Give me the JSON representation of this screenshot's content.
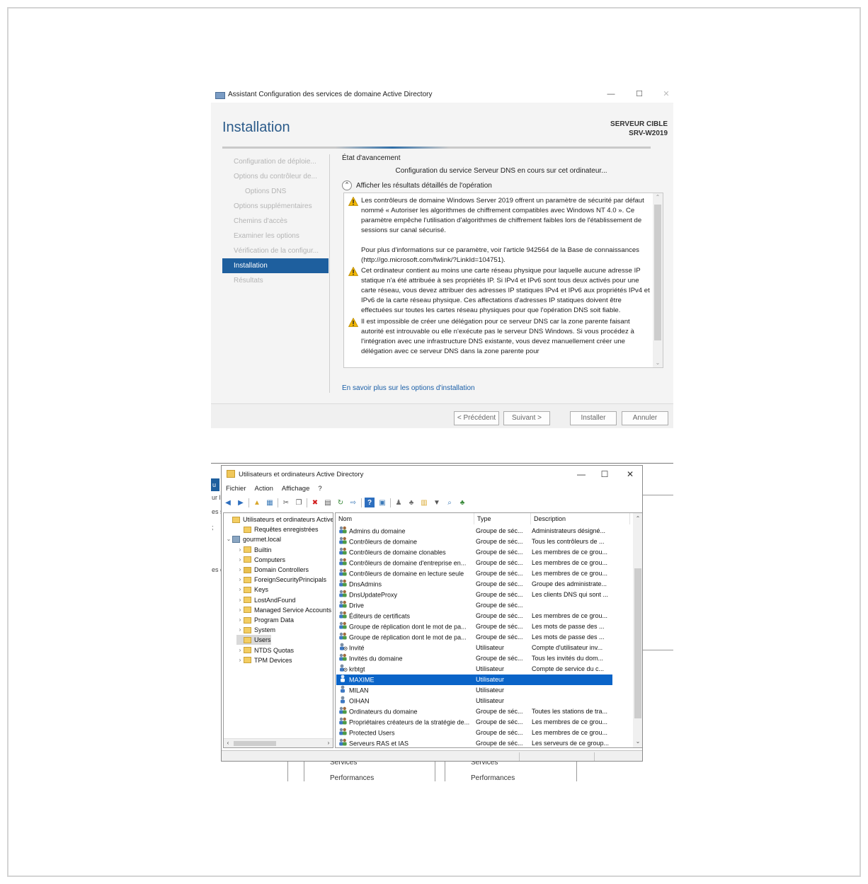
{
  "wizard": {
    "window_title": "Assistant Configuration des services de domaine Active Directory",
    "page_title": "Installation",
    "target_label": "SERVEUR CIBLE",
    "target_server": "SRV-W2019",
    "nav": [
      {
        "label": "Configuration de déploie...",
        "sub": false,
        "active": false
      },
      {
        "label": "Options du contrôleur de...",
        "sub": false,
        "active": false
      },
      {
        "label": "Options DNS",
        "sub": true,
        "active": false
      },
      {
        "label": "Options supplémentaires",
        "sub": false,
        "active": false
      },
      {
        "label": "Chemins d'accès",
        "sub": false,
        "active": false
      },
      {
        "label": "Examiner les options",
        "sub": false,
        "active": false
      },
      {
        "label": "Vérification de la configur...",
        "sub": false,
        "active": false
      },
      {
        "label": "Installation",
        "sub": false,
        "active": true
      },
      {
        "label": "Résultats",
        "sub": false,
        "active": false
      }
    ],
    "progress_label": "État d'avancement",
    "status_text": "Configuration du service Serveur DNS en cours sur cet ordinateur...",
    "toggle_label": "Afficher les résultats détaillés de l'opération",
    "messages": [
      {
        "icon": "warning-icon",
        "text": "Les contrôleurs de domaine Windows Server 2019 offrent un paramètre de sécurité par défaut nommé « Autoriser les algorithmes de chiffrement compatibles avec Windows NT 4.0 ». Ce paramètre empêche l'utilisation d'algorithmes de chiffrement faibles lors de l'établissement de sessions sur canal sécurisé.",
        "extra": "Pour plus d'informations sur ce paramètre, voir l'article 942564 de la Base de connaissances (http://go.microsoft.com/fwlink/?LinkId=104751)."
      },
      {
        "icon": "warning-icon",
        "text": "Cet ordinateur contient au moins une carte réseau physique pour laquelle aucune adresse IP statique n'a été attribuée à ses propriétés IP. Si IPv4 et IPv6 sont tous deux activés pour une carte réseau, vous devez attribuer des adresses IP statiques IPv4 et IPv6 aux propriétés IPv4 et IPv6 de la carte réseau physique. Ces affectations d'adresses IP statiques doivent être effectuées sur toutes les cartes réseau physiques pour que l'opération DNS soit fiable.",
        "extra": ""
      },
      {
        "icon": "warning-icon",
        "text": "Il est impossible de créer une délégation pour ce serveur DNS car la zone parente faisant autorité est introuvable ou elle n'exécute pas le serveur DNS Windows. Si vous procédez à l'intégration avec une infrastructure DNS existante, vous devez manuellement créer une délégation avec ce serveur DNS dans la zone parente pour",
        "extra": ""
      }
    ],
    "learn_more": "En savoir plus sur les options d'installation",
    "buttons": {
      "previous": "< Précédent",
      "next": "Suivant >",
      "install": "Installer",
      "cancel": "Annuler"
    },
    "window_buttons": {
      "minimize": "—",
      "maximize": "☐",
      "close": "✕"
    }
  },
  "background": {
    "tab": "u c",
    "frag_left": [
      "ur l",
      "es s",
      ";",
      "es c"
    ],
    "col_text": [
      "Services",
      "Performances",
      "Services",
      "Performances"
    ]
  },
  "aduc": {
    "window_title": "Utilisateurs et ordinateurs Active Directory",
    "window_buttons": {
      "minimize": "—",
      "maximize": "☐",
      "close": "✕"
    },
    "menu": [
      "Fichier",
      "Action",
      "Affichage",
      "?"
    ],
    "toolbar": [
      "back-arrow-icon",
      "forward-arrow-icon",
      "up-folder-icon",
      "console-tree-icon",
      "cut-icon",
      "copy-icon",
      "delete-icon",
      "properties-icon",
      "refresh-icon",
      "export-list-icon",
      "help-icon",
      "mmc-icon",
      "add-user-icon",
      "add-group-icon",
      "add-ou-icon",
      "filter-icon",
      "find-icon",
      "add-to-group-icon"
    ],
    "tree": [
      {
        "label": "Utilisateurs et ordinateurs Active",
        "level": 0,
        "exp": "",
        "icon": "folder",
        "selected": false
      },
      {
        "label": "Requêtes enregistrées",
        "level": 1,
        "exp": "",
        "icon": "folder",
        "selected": false
      },
      {
        "label": "gourmet.local",
        "level": 0,
        "exp": "⌄",
        "icon": "domain",
        "selected": false
      },
      {
        "label": "Builtin",
        "level": 2,
        "exp": "›",
        "icon": "folder",
        "selected": false
      },
      {
        "label": "Computers",
        "level": 2,
        "exp": "›",
        "icon": "folder",
        "selected": false
      },
      {
        "label": "Domain Controllers",
        "level": 2,
        "exp": "›",
        "icon": "dcfolder",
        "selected": false
      },
      {
        "label": "ForeignSecurityPrincipals",
        "level": 2,
        "exp": "›",
        "icon": "folder",
        "selected": false
      },
      {
        "label": "Keys",
        "level": 2,
        "exp": "›",
        "icon": "folder",
        "selected": false
      },
      {
        "label": "LostAndFound",
        "level": 2,
        "exp": "›",
        "icon": "folder",
        "selected": false
      },
      {
        "label": "Managed Service Accounts",
        "level": 2,
        "exp": "›",
        "icon": "folder",
        "selected": false
      },
      {
        "label": "Program Data",
        "level": 2,
        "exp": "›",
        "icon": "folder",
        "selected": false
      },
      {
        "label": "System",
        "level": 2,
        "exp": "›",
        "icon": "folder",
        "selected": false
      },
      {
        "label": "Users",
        "level": 2,
        "exp": "",
        "icon": "folder",
        "selected": true
      },
      {
        "label": "NTDS Quotas",
        "level": 2,
        "exp": "›",
        "icon": "folder",
        "selected": false
      },
      {
        "label": "TPM Devices",
        "level": 2,
        "exp": "›",
        "icon": "folder",
        "selected": false
      }
    ],
    "columns": [
      "Nom",
      "Type",
      "Description"
    ],
    "rows": [
      {
        "name": "Admins du domaine",
        "type": "Groupe de séc...",
        "desc": "Administrateurs désigné...",
        "icon": "group",
        "selected": false
      },
      {
        "name": "Contrôleurs de domaine",
        "type": "Groupe de séc...",
        "desc": "Tous les contrôleurs de ...",
        "icon": "group",
        "selected": false
      },
      {
        "name": "Contrôleurs de domaine clonables",
        "type": "Groupe de séc...",
        "desc": "Les membres de ce grou...",
        "icon": "group",
        "selected": false
      },
      {
        "name": "Contrôleurs de domaine d'entreprise en...",
        "type": "Groupe de séc...",
        "desc": "Les membres de ce grou...",
        "icon": "group",
        "selected": false
      },
      {
        "name": "Contrôleurs de domaine en lecture seule",
        "type": "Groupe de séc...",
        "desc": "Les membres de ce grou...",
        "icon": "group",
        "selected": false
      },
      {
        "name": "DnsAdmins",
        "type": "Groupe de séc...",
        "desc": "Groupe des administrate...",
        "icon": "group",
        "selected": false
      },
      {
        "name": "DnsUpdateProxy",
        "type": "Groupe de séc...",
        "desc": "Les clients DNS qui sont ...",
        "icon": "group",
        "selected": false
      },
      {
        "name": "Drive",
        "type": "Groupe de séc...",
        "desc": "",
        "icon": "group",
        "selected": false
      },
      {
        "name": "Éditeurs de certificats",
        "type": "Groupe de séc...",
        "desc": "Les membres de ce grou...",
        "icon": "group",
        "selected": false
      },
      {
        "name": "Groupe de réplication dont le mot de pa...",
        "type": "Groupe de séc...",
        "desc": "Les mots de passe des ...",
        "icon": "group",
        "selected": false
      },
      {
        "name": "Groupe de réplication dont le mot de pa...",
        "type": "Groupe de séc...",
        "desc": "Les mots de passe des ...",
        "icon": "group",
        "selected": false
      },
      {
        "name": "Invité",
        "type": "Utilisateur",
        "desc": "Compte d'utilisateur inv...",
        "icon": "user-disabled",
        "selected": false
      },
      {
        "name": "Invités du domaine",
        "type": "Groupe de séc...",
        "desc": "Tous les invités du dom...",
        "icon": "group",
        "selected": false
      },
      {
        "name": "krbtgt",
        "type": "Utilisateur",
        "desc": "Compte de service du c...",
        "icon": "user-disabled",
        "selected": false
      },
      {
        "name": "MAXIME",
        "type": "Utilisateur",
        "desc": "",
        "icon": "user",
        "selected": true
      },
      {
        "name": "MILAN",
        "type": "Utilisateur",
        "desc": "",
        "icon": "user",
        "selected": false
      },
      {
        "name": "OIHAN",
        "type": "Utilisateur",
        "desc": "",
        "icon": "user",
        "selected": false
      },
      {
        "name": "Ordinateurs du domaine",
        "type": "Groupe de séc...",
        "desc": "Toutes les stations de tra...",
        "icon": "group",
        "selected": false
      },
      {
        "name": "Propriétaires créateurs de la stratégie de...",
        "type": "Groupe de séc...",
        "desc": "Les membres de ce grou...",
        "icon": "group",
        "selected": false
      },
      {
        "name": "Protected Users",
        "type": "Groupe de séc...",
        "desc": "Les membres de ce grou...",
        "icon": "group",
        "selected": false
      },
      {
        "name": "Serveurs RAS et IAS",
        "type": "Groupe de séc...",
        "desc": "Les serveurs de ce group...",
        "icon": "group",
        "selected": false
      }
    ]
  },
  "colors": {
    "accent": "#1e5f9e",
    "selection": "#0a64c8",
    "warning": "#f2b705",
    "link": "#1a5fa8",
    "title_blue": "#2b5b8a"
  }
}
